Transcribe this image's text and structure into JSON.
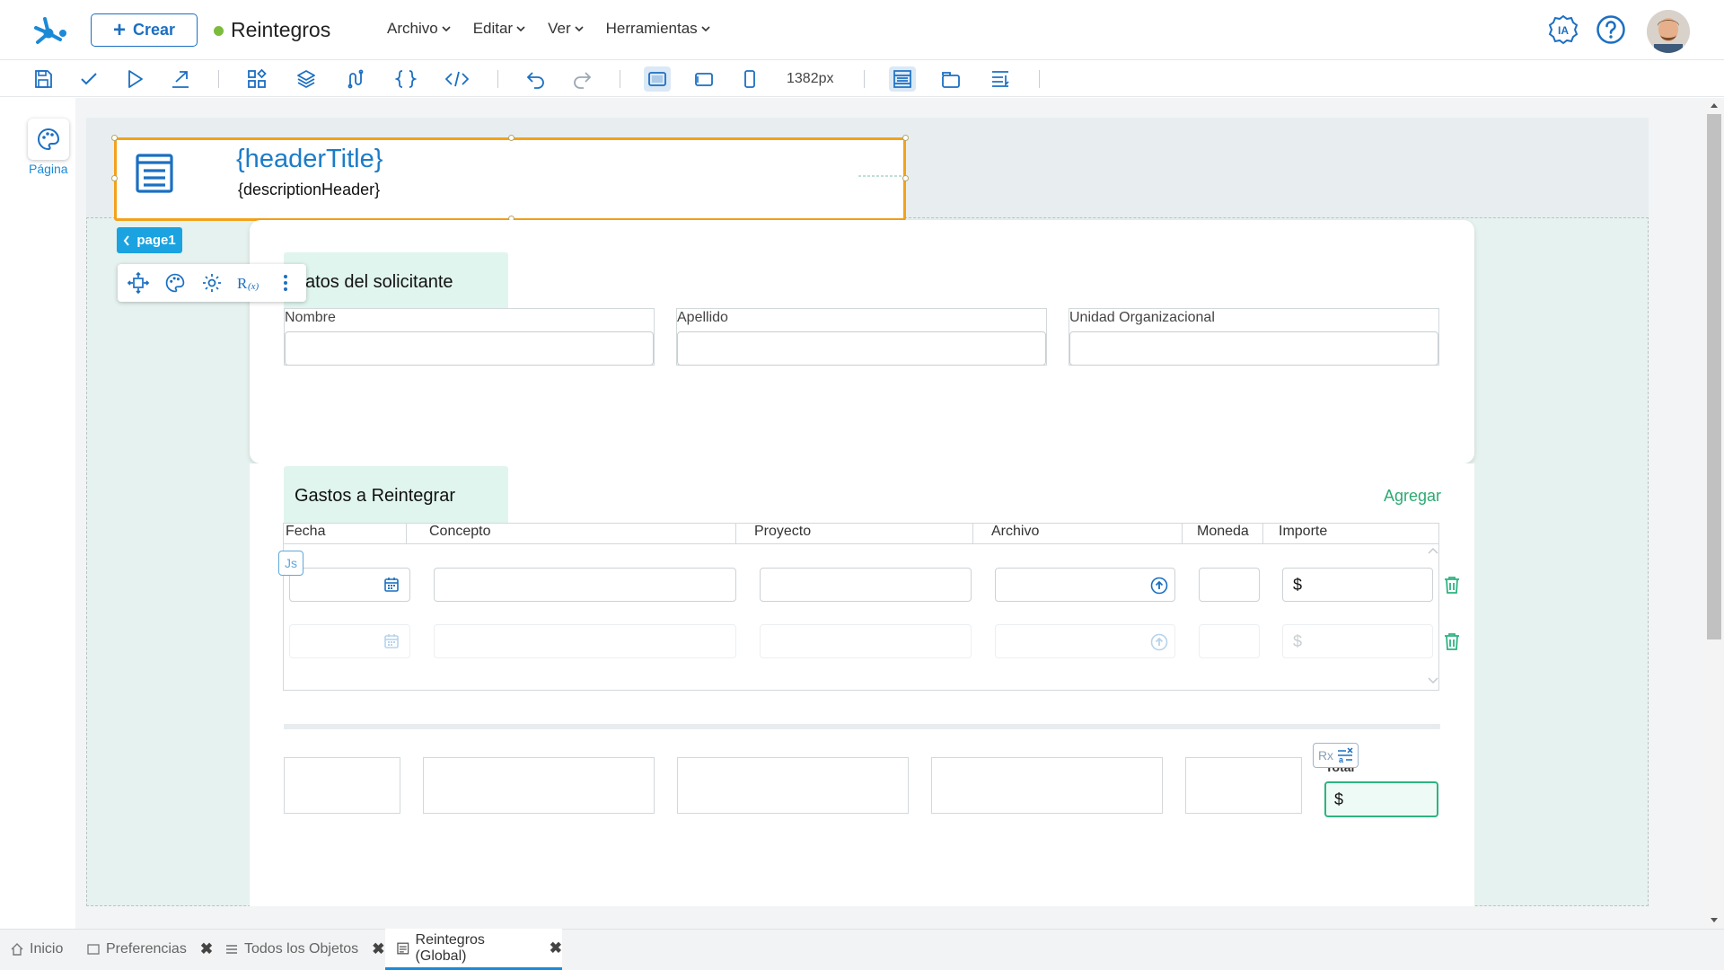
{
  "app": {
    "create_label": "Crear",
    "title": "Reintegros",
    "status_color": "#7cbc3c"
  },
  "menus": [
    "Archivo",
    "Editar",
    "Ver",
    "Herramientas"
  ],
  "top_icons": [
    "ia-icon",
    "help-icon",
    "user-avatar"
  ],
  "ia_label": "IA",
  "toolbar": {
    "width_label": "1382px"
  },
  "left_panel": {
    "page_label": "Página"
  },
  "header": {
    "title": "{headerTitle}",
    "description": "{descriptionHeader}"
  },
  "page_tab": "page1",
  "section1": {
    "title": "atos del solicitante",
    "fields": [
      {
        "label": "Nombre",
        "value": ""
      },
      {
        "label": "Apellido",
        "value": ""
      },
      {
        "label": "Unidad Organizacional",
        "value": ""
      }
    ]
  },
  "section2": {
    "title": "Gastos a Reintegrar",
    "add_label": "Agregar",
    "columns": [
      "Fecha",
      "Concepto",
      "Proyecto",
      "Archivo",
      "Moneda",
      "Importe"
    ],
    "currency_symbol": "$",
    "js_label": "Js"
  },
  "totals": {
    "label": "Total",
    "currency_symbol": "$",
    "rx_label": "Rx"
  },
  "bottom_tabs": [
    {
      "label": "Inicio"
    },
    {
      "label": "Preferencias"
    },
    {
      "label": "Todos los Objetos"
    },
    {
      "label": "Reintegros (Global)"
    }
  ],
  "colors": {
    "accent": "#1b6fc2",
    "selection": "#f3a21a",
    "green": "#2daa72",
    "page_tab": "#1aa3e0"
  }
}
